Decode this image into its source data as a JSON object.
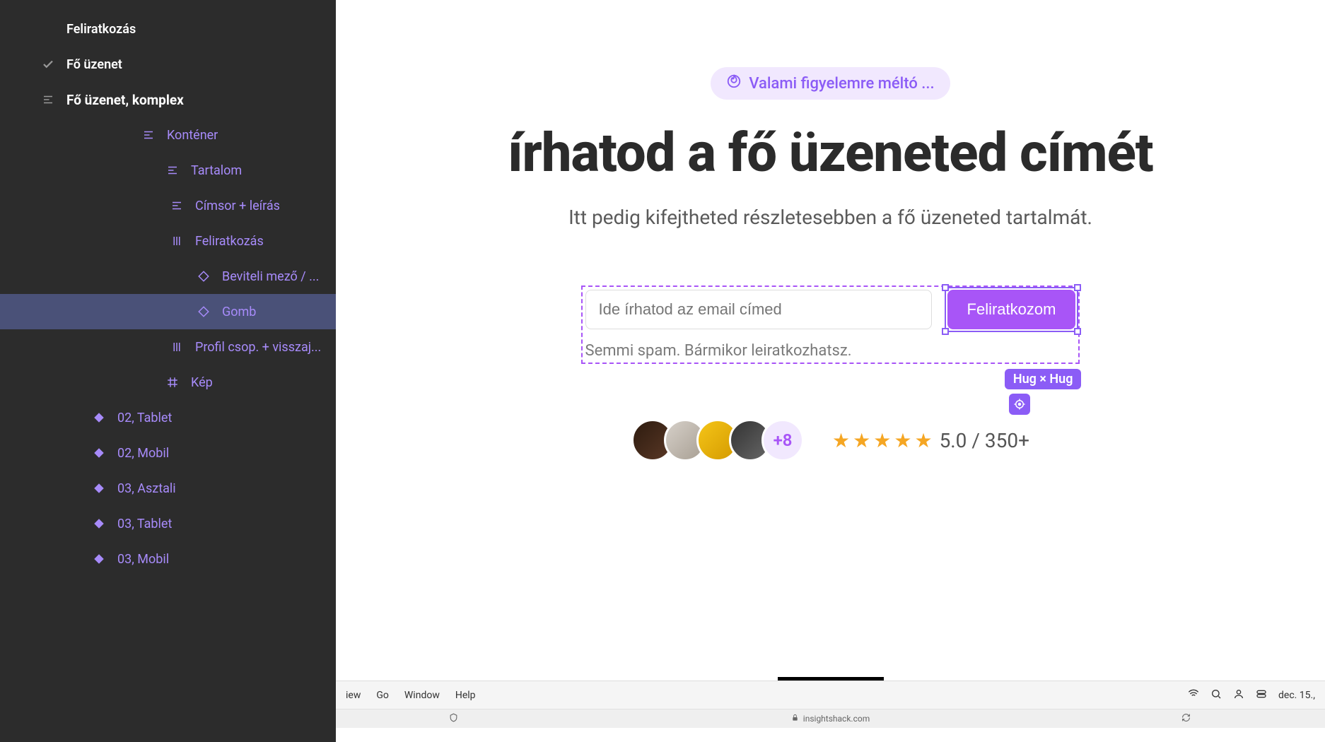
{
  "sidebar": {
    "items": [
      {
        "label": "Feliratkozás",
        "indent": "sub-1",
        "icon": null,
        "style": "white"
      },
      {
        "label": "Fő üzenet",
        "indent": "sub-1",
        "icon": "check",
        "style": "white"
      },
      {
        "label": "Fő üzenet, komplex",
        "indent": "sub-1",
        "icon": "stack",
        "style": "white bold"
      },
      {
        "label": "Konténer",
        "indent": "sub-2",
        "icon": "stack",
        "style": "purple"
      },
      {
        "label": "Tartalom",
        "indent": "sub-3",
        "icon": "stack",
        "style": "purple"
      },
      {
        "label": "Címsor + leírás",
        "indent": "sub-4",
        "icon": "stack",
        "style": "purple"
      },
      {
        "label": "Feliratkozás",
        "indent": "sub-4",
        "icon": "columns",
        "style": "purple"
      },
      {
        "label": "Beviteli mező / ...",
        "indent": "sub-5",
        "icon": "diamond",
        "style": "purple"
      },
      {
        "label": "Gomb",
        "indent": "sub-5",
        "icon": "diamond",
        "style": "purple",
        "selected": true
      },
      {
        "label": "Profil csop. + visszaj...",
        "indent": "sub-4",
        "icon": "columns",
        "style": "purple"
      },
      {
        "label": "Kép",
        "indent": "sub-3",
        "icon": "frame",
        "style": "purple"
      },
      {
        "label": "02, Tablet",
        "indent": "sub-comp",
        "icon": "diamond-fill",
        "style": "purple"
      },
      {
        "label": "02, Mobil",
        "indent": "sub-comp",
        "icon": "diamond-fill",
        "style": "purple"
      },
      {
        "label": "03, Asztali",
        "indent": "sub-comp",
        "icon": "diamond-fill",
        "style": "purple"
      },
      {
        "label": "03, Tablet",
        "indent": "sub-comp",
        "icon": "diamond-fill",
        "style": "purple"
      },
      {
        "label": "03, Mobil",
        "indent": "sub-comp",
        "icon": "diamond-fill",
        "style": "purple"
      }
    ]
  },
  "canvas": {
    "badge_text": "Valami figyelemre méltó ...",
    "headline": "írhatod a fő üzeneted címét",
    "subline": "Itt pedig kifejtheted részletesebben a fő üzeneted tartalmát.",
    "email_placeholder": "Ide írhatod az email címed",
    "subscribe_label": "Feliratkozom",
    "spam_note": "Semmi spam. Bármikor leiratkozhatsz.",
    "hug_label": "Hug × Hug",
    "avatar_more": "+8",
    "rating_text": "5.0 / 350+"
  },
  "browser": {
    "menu": [
      "iew",
      "Go",
      "Window",
      "Help"
    ],
    "date": "dec. 15.,",
    "url": "insightshack.com"
  }
}
